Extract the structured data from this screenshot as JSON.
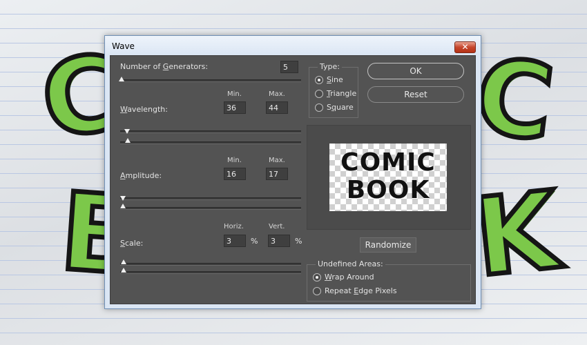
{
  "background": {
    "letters": [
      "C",
      "B",
      "C",
      "K"
    ],
    "accent_color": "#7cc84a"
  },
  "dialog": {
    "title": "Wave",
    "close_label": "✕"
  },
  "generators": {
    "label_prefix": "Number of ",
    "label_accel": "G",
    "label_suffix": "enerators:",
    "value": "5"
  },
  "wavelength": {
    "label_accel": "W",
    "label_rest": "avelength:",
    "min_header": "Min.",
    "max_header": "Max.",
    "min": "36",
    "max": "44"
  },
  "amplitude": {
    "label_accel": "A",
    "label_rest": "mplitude:",
    "min_header": "Min.",
    "max_header": "Max.",
    "min": "16",
    "max": "17"
  },
  "scale": {
    "label_accel": "S",
    "label_rest": "cale:",
    "horiz_header": "Horiz.",
    "vert_header": "Vert.",
    "horiz": "3",
    "vert": "3",
    "unit": "%"
  },
  "type_group": {
    "title": "Type:",
    "options": [
      {
        "accel": "S",
        "rest": "ine",
        "selected": true
      },
      {
        "accel": "T",
        "rest": "riangle",
        "selected": false
      },
      {
        "pre": "S",
        "accel": "q",
        "rest": "uare",
        "selected": false
      }
    ]
  },
  "buttons": {
    "ok": "OK",
    "reset": "Reset",
    "randomize": "Randomize"
  },
  "preview": {
    "line1": "COMIC",
    "line2": "BOOK"
  },
  "undefined_areas": {
    "title": "Undefined Areas:",
    "options": [
      {
        "accel": "W",
        "rest": "rap Around",
        "selected": true
      },
      {
        "pre": "Repeat ",
        "accel": "E",
        "rest": "dge Pixels",
        "selected": false
      }
    ]
  }
}
